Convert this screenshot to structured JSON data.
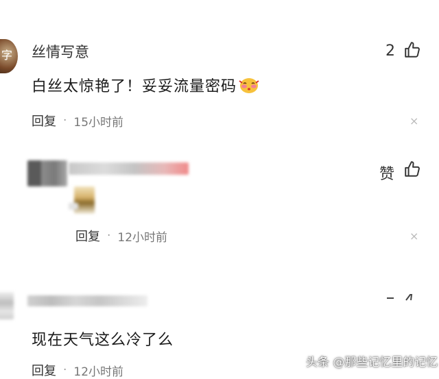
{
  "comments": [
    {
      "username": "丝情写意",
      "text": "白丝太惊艳了！妥妥流量密码",
      "reply_label": "回复",
      "separator": "·",
      "time": "15小时前",
      "like_count": "2",
      "avatar_text": "字",
      "icons": {
        "like": "thumbs-up-icon",
        "close": "close-icon",
        "emoji": "blush-face-emoji"
      }
    },
    {
      "username": "",
      "text": "",
      "reply_label": "回复",
      "separator": "·",
      "time": "12小时前",
      "like_label": "赞",
      "icons": {
        "like": "thumbs-up-icon",
        "close": "close-icon"
      }
    },
    {
      "username": "",
      "text": "现在天气这么冷了么",
      "reply_label": "回复",
      "separator": "·",
      "time": "12小时前",
      "icons": {
        "like": "thumbs-up-icon"
      }
    }
  ],
  "close_glyph": "×",
  "watermark": "头条 @那些记忆里的记忆",
  "colors": {
    "accent_red": "#d9332b",
    "blush_pink": "#f47f95",
    "emoji_yellow": "#f7c23c"
  }
}
